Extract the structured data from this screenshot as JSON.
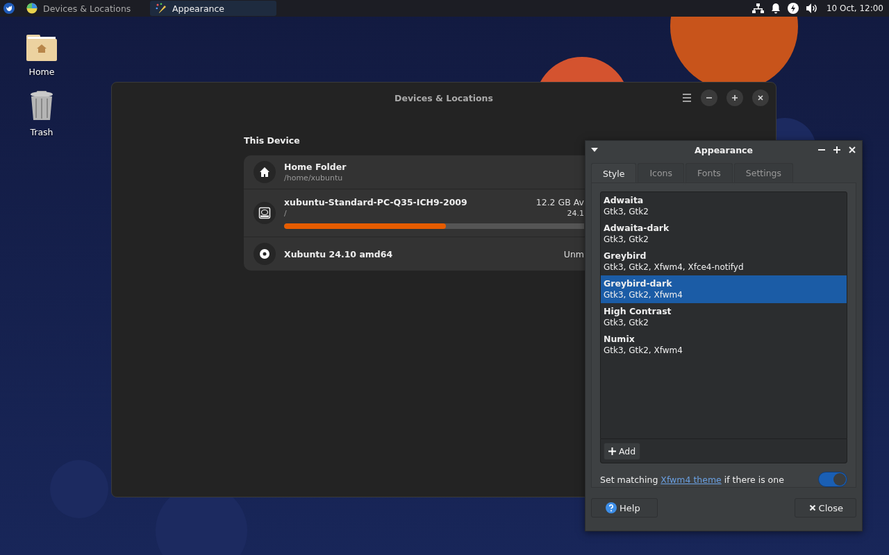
{
  "taskbar": {
    "tasks": [
      {
        "label": "Devices & Locations",
        "kind": "chart",
        "selected": false
      },
      {
        "label": "Appearance",
        "kind": "wand",
        "selected": true
      }
    ],
    "clock": "10 Oct, 12:00"
  },
  "desktop_icons": [
    {
      "label": "Home",
      "kind": "folder"
    },
    {
      "label": "Trash",
      "kind": "trash"
    }
  ],
  "devices_window": {
    "title": "Devices & Locations",
    "section": "This Device",
    "items": [
      {
        "kind": "home",
        "name": "Home Folder",
        "path": "/home/xubuntu"
      },
      {
        "kind": "disk",
        "name": "xubuntu-Standard-PC-Q35-ICH9-2009",
        "path": "/",
        "free": "12.2 GB Av",
        "size": "24.1",
        "level": 0.54
      },
      {
        "kind": "disc",
        "name": "Xubuntu 24.10 amd64",
        "status": "Unm"
      }
    ]
  },
  "appearance_window": {
    "title": "Appearance",
    "tabs": [
      {
        "label": "Style",
        "selected": true
      },
      {
        "label": "Icons",
        "selected": false
      },
      {
        "label": "Fonts",
        "selected": false
      },
      {
        "label": "Settings",
        "selected": false
      }
    ],
    "themes": [
      {
        "name": "Adwaita",
        "details": "Gtk3, Gtk2",
        "selected": false
      },
      {
        "name": "Adwaita-dark",
        "details": "Gtk3, Gtk2",
        "selected": false
      },
      {
        "name": "Greybird",
        "details": "Gtk3, Gtk2, Xfwm4, Xfce4-notifyd",
        "selected": false
      },
      {
        "name": "Greybird-dark",
        "details": "Gtk3, Gtk2, Xfwm4",
        "selected": true
      },
      {
        "name": "High Contrast",
        "details": "Gtk3, Gtk2",
        "selected": false
      },
      {
        "name": "Numix",
        "details": "Gtk3, Gtk2, Xfwm4",
        "selected": false
      }
    ],
    "add_button": "Add",
    "matching": {
      "before": "Set matching ",
      "link": "Xfwm4 theme",
      "after": " if there is one",
      "on": true
    },
    "buttons": [
      {
        "label": "Help",
        "kind": "help"
      },
      {
        "label": "Close",
        "kind": "close"
      }
    ]
  }
}
